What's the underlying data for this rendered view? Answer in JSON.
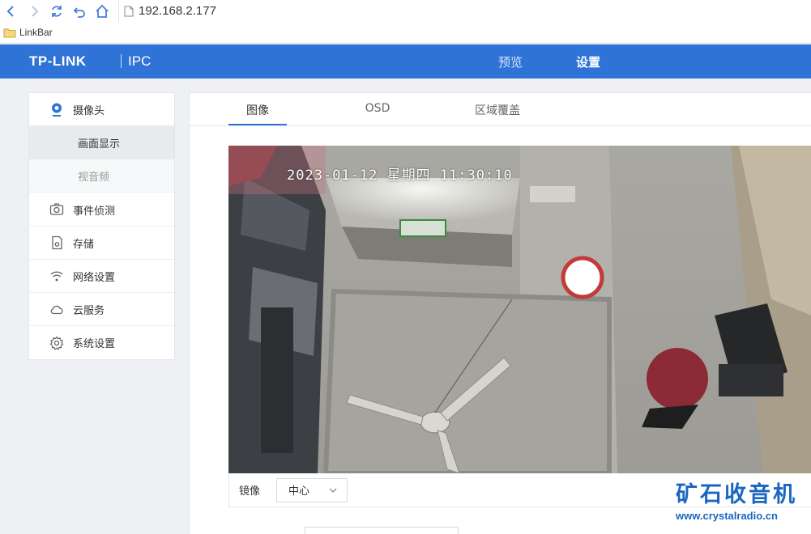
{
  "browser": {
    "url": "192.168.2.177",
    "bookmark_folder": "LinkBar"
  },
  "header": {
    "brand": "TP-LINK",
    "product": "IPC",
    "tabs": [
      {
        "label": "预览",
        "active": false
      },
      {
        "label": "设置",
        "active": true
      }
    ]
  },
  "sidebar": {
    "camera": {
      "label": "摄像头",
      "icon": "webcam-icon"
    },
    "sub_items": [
      {
        "label": "画面显示",
        "active": true
      },
      {
        "label": "视音频",
        "active": false
      }
    ],
    "items": [
      {
        "label": "事件侦测",
        "icon": "camera-icon"
      },
      {
        "label": "存储",
        "icon": "storage-icon"
      },
      {
        "label": "网络设置",
        "icon": "wifi-icon"
      },
      {
        "label": "云服务",
        "icon": "cloud-icon"
      },
      {
        "label": "系统设置",
        "icon": "gear-icon"
      }
    ]
  },
  "content": {
    "tabs": [
      {
        "label": "图像",
        "active": true
      },
      {
        "label": "OSD",
        "active": false
      },
      {
        "label": "区域覆盖",
        "active": false
      }
    ],
    "video_osd_text": "2023-01-12 星期四 11:30:10",
    "mirror": {
      "label": "镜像",
      "value": "中心"
    }
  },
  "watermark": {
    "text": "矿石收音机",
    "url": "www.crystalradio.cn"
  },
  "colors": {
    "header_bg": "#2f73d6",
    "accent": "#2f73d6",
    "watermark": "#1a67c2"
  }
}
